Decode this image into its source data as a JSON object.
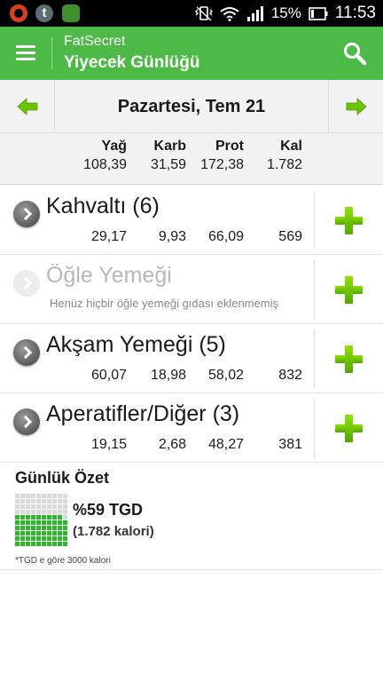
{
  "status_bar": {
    "battery": "15%",
    "time": "11:53",
    "app_icons": [
      "chrome-icon",
      "tumblr-icon",
      "android-app-icon"
    ]
  },
  "app_bar": {
    "brand": "FatSecret",
    "title": "Yiyecek Günlüğü",
    "menu_icon": "hamburger-icon",
    "search_icon": "search-icon"
  },
  "date_nav": {
    "date": "Pazartesi, Tem 21",
    "prev_icon": "arrow-left-icon",
    "next_icon": "arrow-right-icon"
  },
  "totals": {
    "headers": [
      "Yağ",
      "Karb",
      "Prot",
      "Kal"
    ],
    "values": [
      "108,39",
      "31,59",
      "172,38",
      "1.782"
    ]
  },
  "meals": [
    {
      "name": "Kahvaltı (6)",
      "values": [
        "29,17",
        "9,93",
        "66,09",
        "569"
      ]
    },
    {
      "name": "Öğle Yemeği",
      "subtitle": "Henüz hiçbir öğle yemeği gıdası eklenmemiş",
      "values": []
    },
    {
      "name": "Akşam Yemeği (5)",
      "values": [
        "60,07",
        "18,98",
        "58,02",
        "832"
      ]
    },
    {
      "name": "Aperatifler/Diğer (3)",
      "values": [
        "19,15",
        "2,68",
        "48,27",
        "381"
      ]
    }
  ],
  "summary": {
    "title": "Günlük Özet",
    "percent_label": "%59 TGD",
    "percent_value": 59,
    "calories": "(1.782 kalori)",
    "note": "*TGD e göre 3000 kalori"
  },
  "colors": {
    "brand_green": "#4db947",
    "plus_green": "#6cc400",
    "grid_filled": "#2bb82b",
    "grid_empty": "#d9d9d9"
  }
}
